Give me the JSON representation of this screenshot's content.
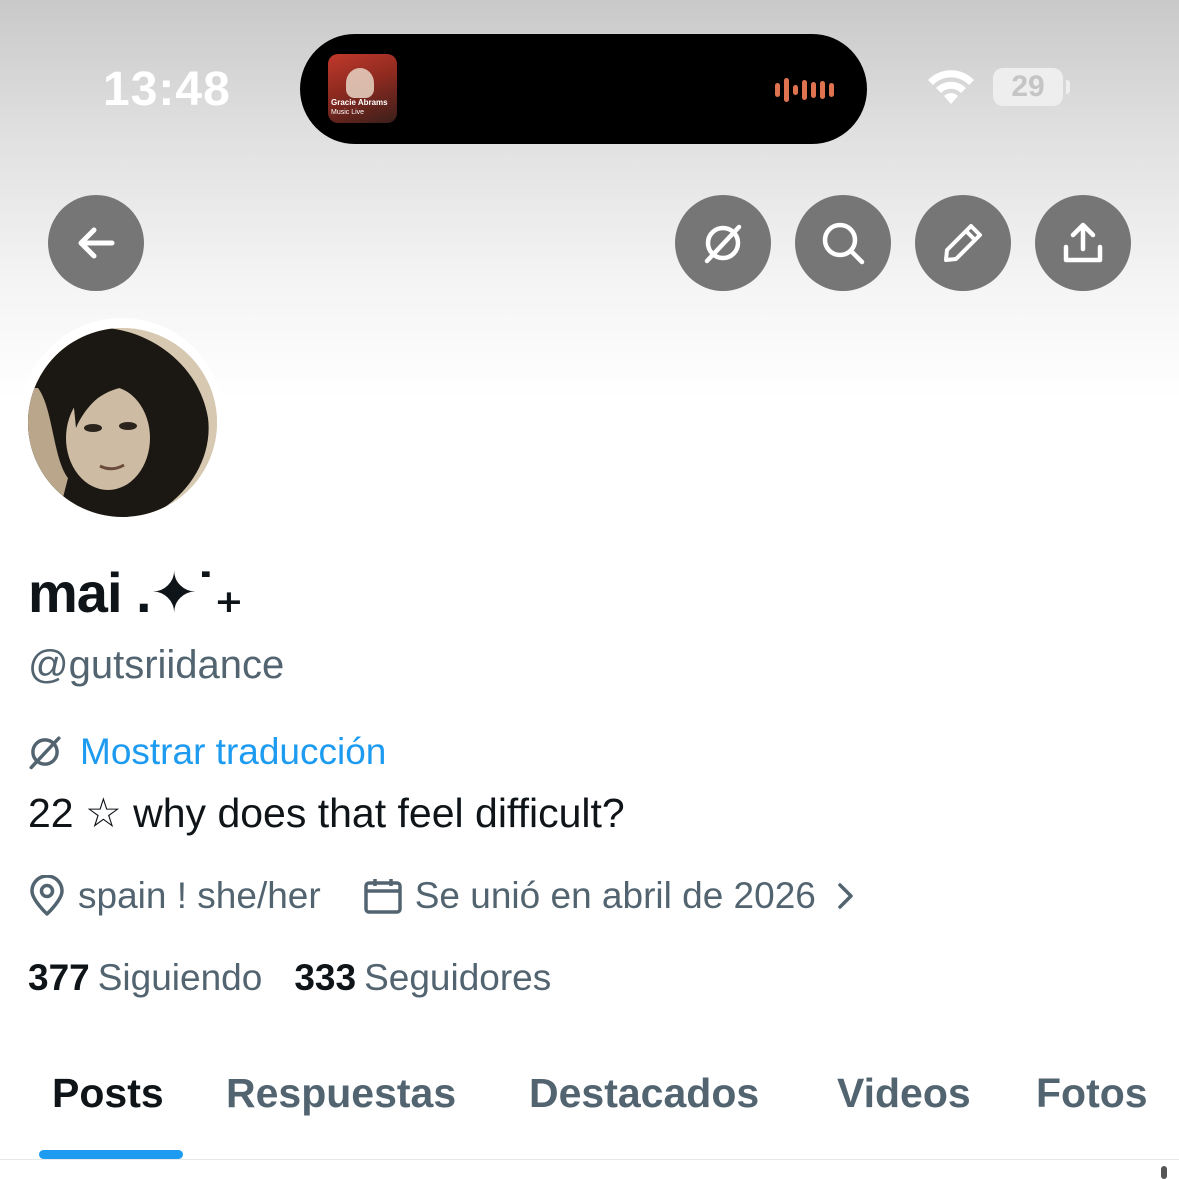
{
  "status_bar": {
    "time": "13:48",
    "battery_level": "29",
    "now_playing": {
      "title_line": "Gracie Abrams",
      "subtitle_line": "Music Live",
      "icon": "audio-waveform-icon",
      "waveform_color": "#e0734f"
    }
  },
  "nav": {
    "back_icon": "arrow-left-icon",
    "actions": [
      "translate-icon",
      "search-icon",
      "edit-pencil-icon",
      "share-upload-icon"
    ]
  },
  "profile": {
    "display_name": "mai .✦˙₊",
    "handle": "@gutsriidance",
    "translate_label": "Mostrar traducción",
    "bio": "22 ☆ why does that feel difficult?",
    "location": "spain ! she/her",
    "joined": "Se unió en abril de 2026",
    "following_count": "377",
    "following_label": "Siguiendo",
    "followers_count": "333",
    "followers_label": "Seguidores"
  },
  "tabs": [
    {
      "label": "Posts",
      "active": true
    },
    {
      "label": "Respuestas",
      "active": false
    },
    {
      "label": "Destacados",
      "active": false
    },
    {
      "label": "Videos",
      "active": false
    },
    {
      "label": "Fotos",
      "active": false
    }
  ],
  "colors": {
    "accent": "#1d9bf0",
    "text_primary": "#0f1419",
    "text_secondary": "#536471",
    "nav_button": "#767676"
  }
}
